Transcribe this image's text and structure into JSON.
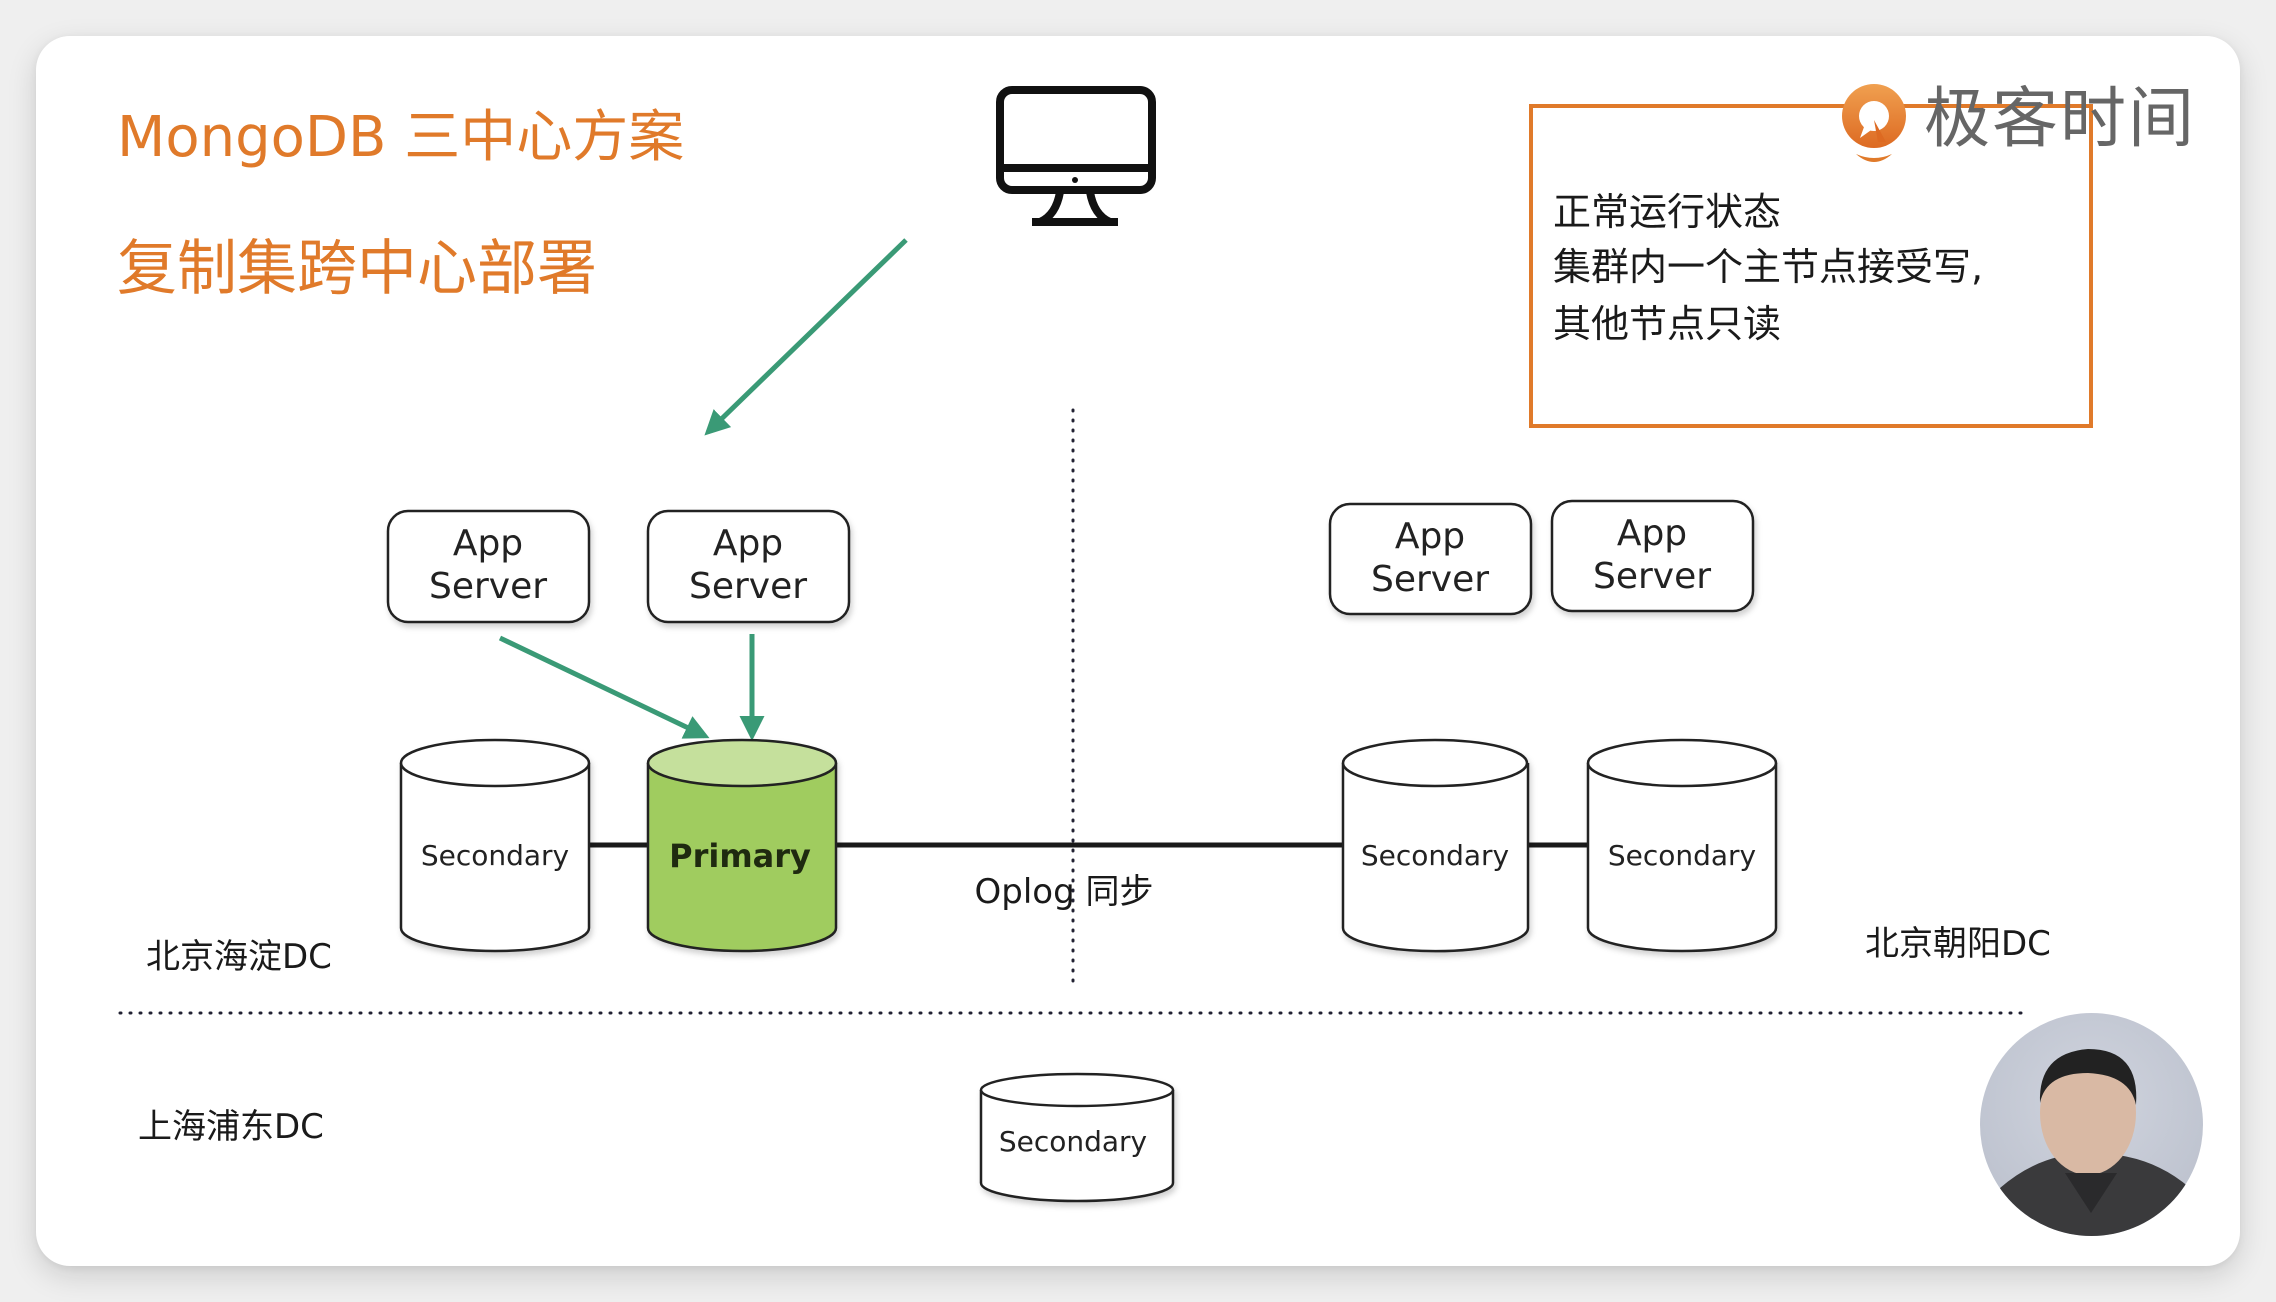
{
  "slide": {
    "title": "MongoDB 三中心方案",
    "subtitle": "复制集跨中心部署",
    "brand": {
      "name": "极客时间",
      "icon": "geektime-logo-icon",
      "color": "#e07a2a"
    },
    "accent_color": "#e07a2a",
    "arrow_color": "#3a9a76",
    "primary_color": "#a0cc5e"
  },
  "note": {
    "lines": [
      "正常运行状态",
      "集群内一个主节点接受写,",
      "其他节点只读"
    ]
  },
  "client": {
    "icon": "desktop-monitor-icon"
  },
  "datacenters": [
    {
      "name": "北京海淀DC",
      "app_servers": [
        {
          "line1": "App",
          "line2": "Server"
        },
        {
          "line1": "App",
          "line2": "Server"
        }
      ],
      "nodes": [
        {
          "role": "Secondary"
        },
        {
          "role": "Primary"
        }
      ]
    },
    {
      "name": "北京朝阳DC",
      "app_servers": [
        {
          "line1": "App",
          "line2": "Server"
        },
        {
          "line1": "App",
          "line2": "Server"
        }
      ],
      "nodes": [
        {
          "role": "Secondary"
        },
        {
          "role": "Secondary"
        }
      ]
    },
    {
      "name": "上海浦东DC",
      "app_servers": [],
      "nodes": [
        {
          "role": "Secondary"
        }
      ]
    }
  ],
  "replication_label": "Oplog 同步",
  "presenter_video": {
    "icon": "presenter-video-avatar"
  }
}
